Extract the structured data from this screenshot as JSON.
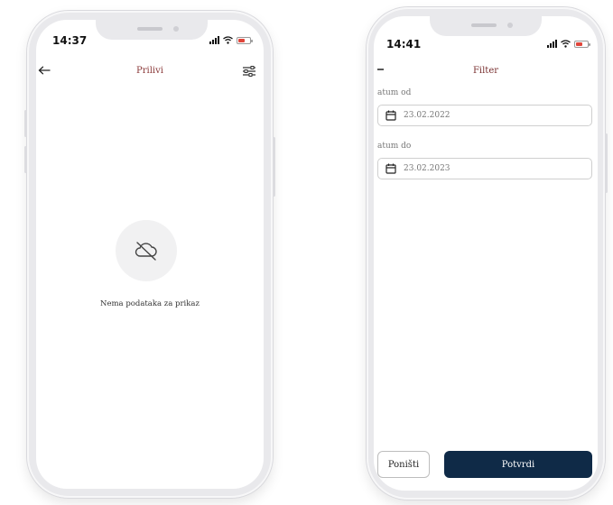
{
  "left_phone": {
    "status": {
      "time": "14:37"
    },
    "header": {
      "title": "Prilivi",
      "back_icon": "arrow-left-icon",
      "filter_icon": "sliders-icon"
    },
    "empty_state": {
      "icon": "cloud-off-icon",
      "message": "Nema podataka za prikaz"
    }
  },
  "right_phone": {
    "status": {
      "time": "14:41"
    },
    "header": {
      "title": "Filter",
      "back_icon": "arrow-left-icon"
    },
    "fields": [
      {
        "label": "atum od",
        "value": "23.02.2022",
        "icon": "calendar-icon"
      },
      {
        "label": "atum do",
        "value": "23.02.2023",
        "icon": "calendar-icon"
      }
    ],
    "buttons": {
      "cancel": "Poništi",
      "confirm": "Potvrdi"
    }
  },
  "colors": {
    "title": "#8b3a3a",
    "confirm_button": "#0f2a47",
    "battery": "#e0453a"
  }
}
